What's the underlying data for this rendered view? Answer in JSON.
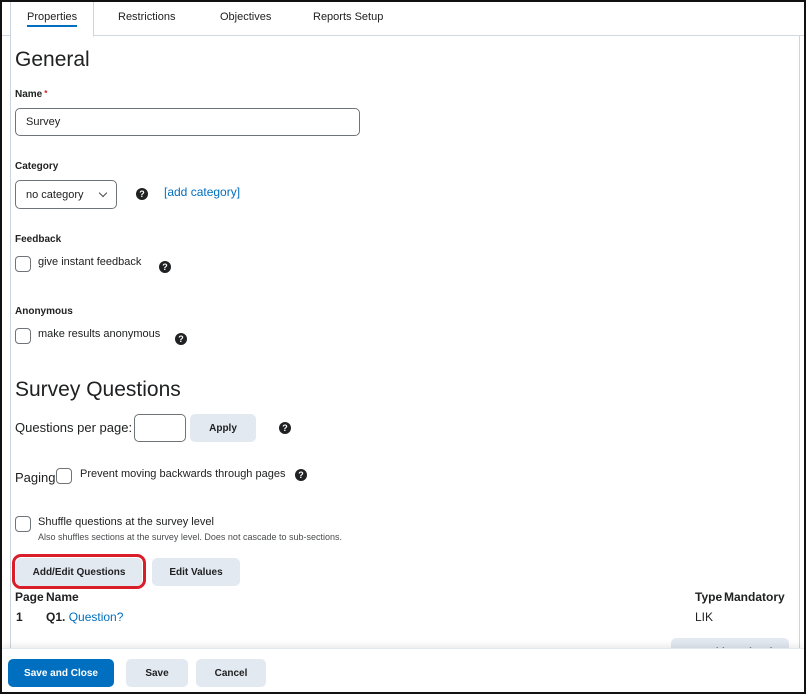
{
  "tabs": [
    {
      "label": "Properties",
      "active": true
    },
    {
      "label": "Restrictions"
    },
    {
      "label": "Objectives"
    },
    {
      "label": "Reports Setup"
    }
  ],
  "general": {
    "heading": "General",
    "name_label": "Name",
    "name_required_mark": "*",
    "name_value": "Survey",
    "category_label": "Category",
    "category_value": "no category",
    "add_category_link": "[add category]",
    "feedback_label": "Feedback",
    "feedback_checkbox": "give instant feedback",
    "anonymous_label": "Anonymous",
    "anonymous_checkbox": "make results anonymous"
  },
  "survey_questions": {
    "heading": "Survey Questions",
    "per_page_label": "Questions per page:",
    "per_page_value": "",
    "apply_button": "Apply",
    "paging_label": "Paging:",
    "paging_checkbox": "Prevent moving backwards through pages",
    "shuffle_checkbox": "Shuffle questions at the survey level",
    "shuffle_note": "Also shuffles sections at the survey level. Does not cascade to sub-sections.",
    "add_edit_button": "Add/Edit Questions",
    "edit_values_button": "Edit Values",
    "columns": [
      "Page",
      "Name",
      "Type",
      "Mandatory"
    ],
    "rows": [
      {
        "page": "1",
        "number": "Q1.",
        "name": "Question?",
        "type": "LIK",
        "mandatory": ""
      }
    ],
    "branching_button": "Branching Wizard"
  },
  "footer": {
    "save_close": "Save and Close",
    "save": "Save",
    "cancel": "Cancel"
  },
  "colors": {
    "accent": "#006fbf",
    "highlight": "#d91e2a",
    "button_bg": "#e3e9f1"
  }
}
